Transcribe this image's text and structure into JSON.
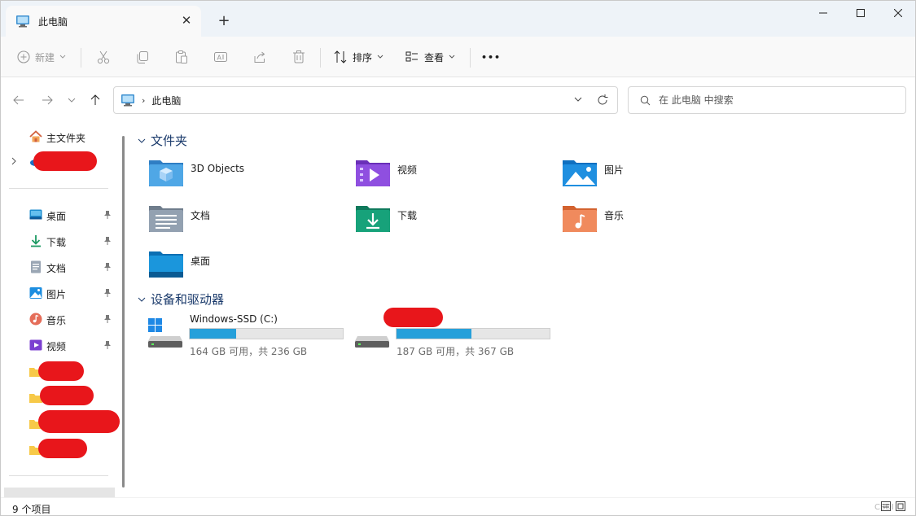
{
  "window": {
    "tab_title": "此电脑",
    "tab_icon": "this-pc-icon",
    "new_tab_symbol": "+",
    "controls": [
      "minimize-icon",
      "maximize-icon",
      "close-icon"
    ]
  },
  "commandbar": {
    "new_label": "新建",
    "sort_label": "排序",
    "view_label": "查看",
    "more_symbol": "•••",
    "icons": [
      "new-icon",
      "cut-icon",
      "copy-icon",
      "paste-icon",
      "rename-icon",
      "share-icon",
      "delete-icon",
      "sort-icon",
      "view-icon",
      "more-icon"
    ]
  },
  "address": {
    "location": "此电脑",
    "search_placeholder": "在 此电脑 中搜索"
  },
  "sidebar": {
    "home_label": "主文件夹",
    "pinned": [
      {
        "label": "桌面",
        "icon": "desktop-icon"
      },
      {
        "label": "下载",
        "icon": "download-icon"
      },
      {
        "label": "文档",
        "icon": "document-icon"
      },
      {
        "label": "图片",
        "icon": "picture-icon"
      },
      {
        "label": "音乐",
        "icon": "music-icon"
      },
      {
        "label": "视频",
        "icon": "video-icon"
      }
    ]
  },
  "main": {
    "folders_header": "文件夹",
    "folders": [
      {
        "label": "3D Objects",
        "icon": "3d-objects-folder-icon"
      },
      {
        "label": "视频",
        "icon": "videos-folder-icon"
      },
      {
        "label": "图片",
        "icon": "pictures-folder-icon"
      },
      {
        "label": "文档",
        "icon": "documents-folder-icon"
      },
      {
        "label": "下载",
        "icon": "downloads-folder-icon"
      },
      {
        "label": "音乐",
        "icon": "music-folder-icon"
      },
      {
        "label": "桌面",
        "icon": "desktop-folder-icon"
      }
    ],
    "drives_header": "设备和驱动器",
    "drives": [
      {
        "name": "Windows-SSD (C:)",
        "free_text": "164 GB 可用，共 236 GB",
        "used_fraction": 0.305
      },
      {
        "name": "",
        "free_text": "187 GB 可用，共 367 GB",
        "used_fraction": 0.49
      }
    ]
  },
  "status": {
    "count": "9 个项目",
    "watermark": "CSDI"
  },
  "colors": {
    "accent": "#26a0da",
    "header_text": "#1a3a6b",
    "redaction": "#e8161b"
  }
}
